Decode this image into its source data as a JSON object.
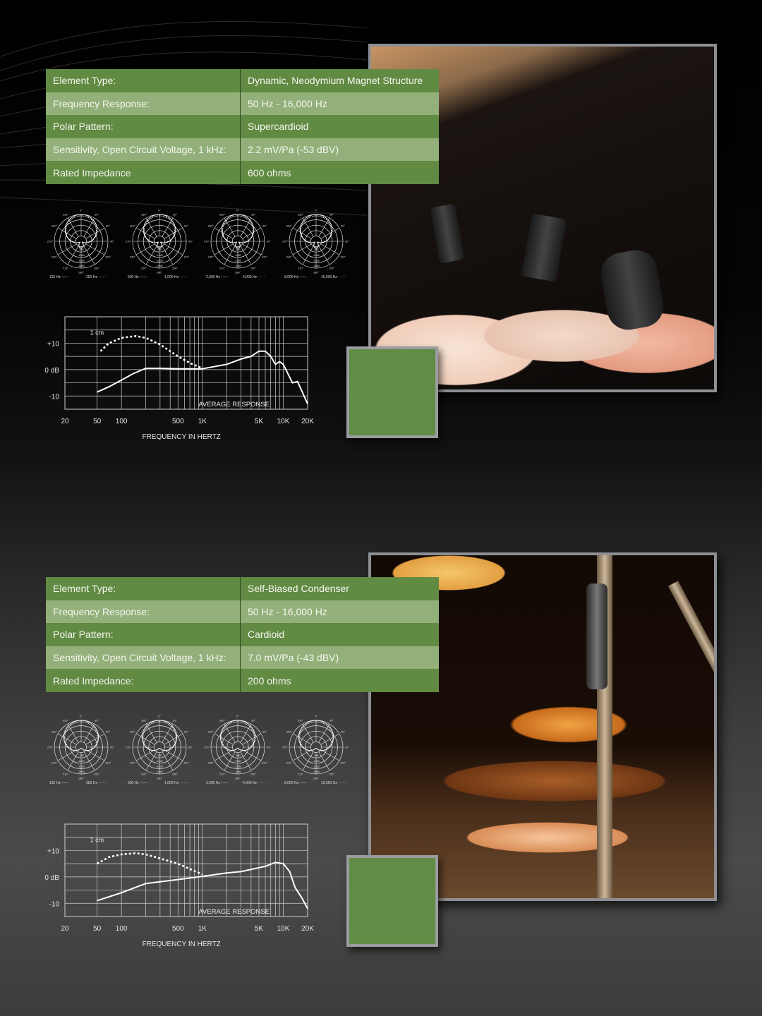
{
  "colors": {
    "table_dark_row": "#618a43",
    "table_light_row": "#93b07a",
    "accent_green": "#628c45",
    "frame_gray": "#8d8f93"
  },
  "sections": [
    {
      "specs": [
        {
          "label": "Element Type:",
          "value": "Dynamic, Neodymium Magnet Structure"
        },
        {
          "label": "Frequency Response:",
          "value": "50 Hz - 16,000 Hz"
        },
        {
          "label": "Polar Pattern:",
          "value": "Supercardioid"
        },
        {
          "label": "Sensitivity, Open Circuit Voltage, 1 kHz:",
          "value": "2.2 mV/Pa (-53 dBV)"
        },
        {
          "label": "Rated Impedance",
          "value": "600 ohms"
        }
      ],
      "polar_plots": [
        {
          "legend_solid": "125 Hz",
          "legend_dashed": "250 Hz",
          "pattern": "supercardioid"
        },
        {
          "legend_solid": "500 Hz",
          "legend_dashed": "1,000 Hz",
          "pattern": "supercardioid"
        },
        {
          "legend_solid": "2,000 Hz",
          "legend_dashed": "4,000 Hz",
          "pattern": "supercardioid"
        },
        {
          "legend_solid": "8,000 Hz",
          "legend_dashed": "16,000 Hz",
          "pattern": "supercardioid"
        }
      ],
      "photo": "Dynamic microphones clipped on drum toms"
    },
    {
      "specs": [
        {
          "label": "Element Type:",
          "value": "Self-Biased Condenser"
        },
        {
          "label": "Frequency Response:",
          "value": "50 Hz - 16,000 Hz"
        },
        {
          "label": "Polar Pattern:",
          "value": "Cardioid"
        },
        {
          "label": "Sensitivity, Open Circuit Voltage, 1 kHz:",
          "value": "7.0 mV/Pa (-43 dBV)"
        },
        {
          "label": "Rated Impedance:",
          "value": "200 ohms"
        }
      ],
      "polar_plots": [
        {
          "legend_solid": "125 Hz",
          "legend_dashed": "250 Hz",
          "pattern": "cardioid"
        },
        {
          "legend_solid": "500 Hz",
          "legend_dashed": "1,000 Hz",
          "pattern": "cardioid"
        },
        {
          "legend_solid": "2,000 Hz",
          "legend_dashed": "4,000 Hz",
          "pattern": "cardioid"
        },
        {
          "legend_solid": "8,000 Hz",
          "legend_dashed": "16,000 Hz",
          "pattern": "cardioid"
        }
      ],
      "photo": "Condenser overhead microphone over cymbals and drum kit"
    }
  ],
  "polar_labels": {
    "angles": [
      "0°",
      "30°",
      "60°",
      "90°",
      "120°",
      "150°",
      "180°",
      "210°",
      "240°",
      "270°",
      "300°",
      "330°"
    ],
    "rings": [
      "-5dB",
      "-10dB",
      "-15dB",
      "-20dB"
    ]
  },
  "chart_data": [
    {
      "type": "line",
      "title": "",
      "xlabel": "FREQUENCY IN HERTZ",
      "ylabel": "",
      "annotation": "AVERAGE RESPONSE",
      "xscale": "log",
      "xlim": [
        20,
        20000
      ],
      "ylim": [
        -15,
        20
      ],
      "x_ticks": [
        "20",
        "50",
        "100",
        "500",
        "1K",
        "5K",
        "10K",
        "20K"
      ],
      "y_ticks": [
        "+10",
        "0 dB",
        "-10"
      ],
      "grid": true,
      "series": [
        {
          "name": "AVERAGE RESPONSE",
          "style": "solid",
          "x": [
            50,
            70,
            100,
            140,
            200,
            300,
            500,
            1000,
            2000,
            3000,
            4000,
            5000,
            6000,
            7000,
            8000,
            9000,
            10000,
            13000,
            15000,
            20000
          ],
          "y": [
            -8.5,
            -6.5,
            -4,
            -1.5,
            0.5,
            0.5,
            0.3,
            0.3,
            2,
            4,
            5,
            7,
            7,
            5,
            2,
            3,
            2,
            -5,
            -4.5,
            -13
          ]
        },
        {
          "name": "1 cm",
          "style": "dashed",
          "x": [
            55,
            70,
            100,
            150,
            200,
            300,
            500,
            700,
            1000
          ],
          "y": [
            7,
            10,
            12,
            12.7,
            12,
            9.5,
            5,
            2.5,
            0.5
          ]
        }
      ]
    },
    {
      "type": "line",
      "title": "",
      "xlabel": "FREQUENCY IN HERTZ",
      "ylabel": "",
      "annotation": "AVERAGE RESPONSE",
      "xscale": "log",
      "xlim": [
        20,
        20000
      ],
      "ylim": [
        -15,
        20
      ],
      "x_ticks": [
        "20",
        "50",
        "100",
        "500",
        "1K",
        "5K",
        "10K",
        "20K"
      ],
      "y_ticks": [
        "+10",
        "0 dB",
        "-10"
      ],
      "grid": true,
      "series": [
        {
          "name": "AVERAGE RESPONSE",
          "style": "solid",
          "x": [
            50,
            100,
            200,
            500,
            1000,
            2000,
            3000,
            5000,
            6000,
            8000,
            10000,
            12000,
            14000,
            17000,
            20000
          ],
          "y": [
            -9,
            -6,
            -2.5,
            -1,
            0.2,
            1.5,
            2,
            3.5,
            4,
            5.5,
            5,
            2,
            -4,
            -8,
            -12
          ]
        },
        {
          "name": "1 cm",
          "style": "dashed",
          "x": [
            50,
            70,
            100,
            150,
            200,
            300,
            500,
            700,
            1000
          ],
          "y": [
            5,
            7.5,
            8.5,
            9,
            8.5,
            7,
            5,
            3,
            1
          ]
        }
      ]
    }
  ]
}
